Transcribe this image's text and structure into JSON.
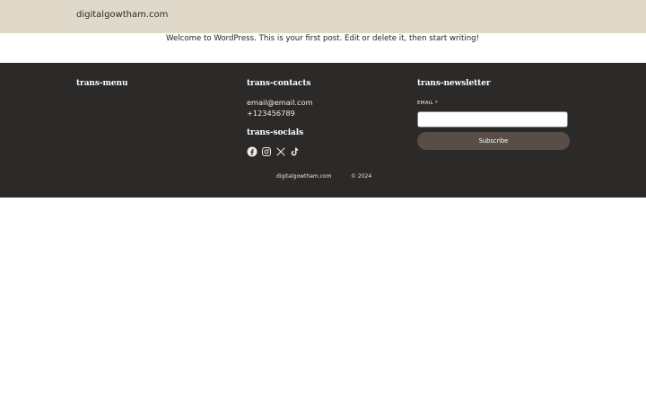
{
  "header": {
    "site_title": "digitalgowtham.com"
  },
  "post": {
    "text": "Welcome to WordPress. This is your first post. Edit or delete it, then start writing!"
  },
  "footer": {
    "menu_heading": "trans-menu",
    "contacts_heading": "trans-contacts",
    "email": "email@email.com",
    "phone": "+123456789",
    "socials_heading": "trans-socials",
    "social_icons": [
      "facebook-icon",
      "instagram-icon",
      "x-icon",
      "tiktok-icon"
    ],
    "newsletter_heading": "trans-newsletter",
    "email_label": "EMAIL *",
    "email_input_value": "",
    "subscribe_label": "Subscribe",
    "copyright_site": "digitalgowtham.com",
    "copyright_year": "© 2024"
  },
  "colors": {
    "header_bg": "#e0d8c8",
    "footer_bg": "#2b2a28",
    "button_bg": "#584e47"
  }
}
